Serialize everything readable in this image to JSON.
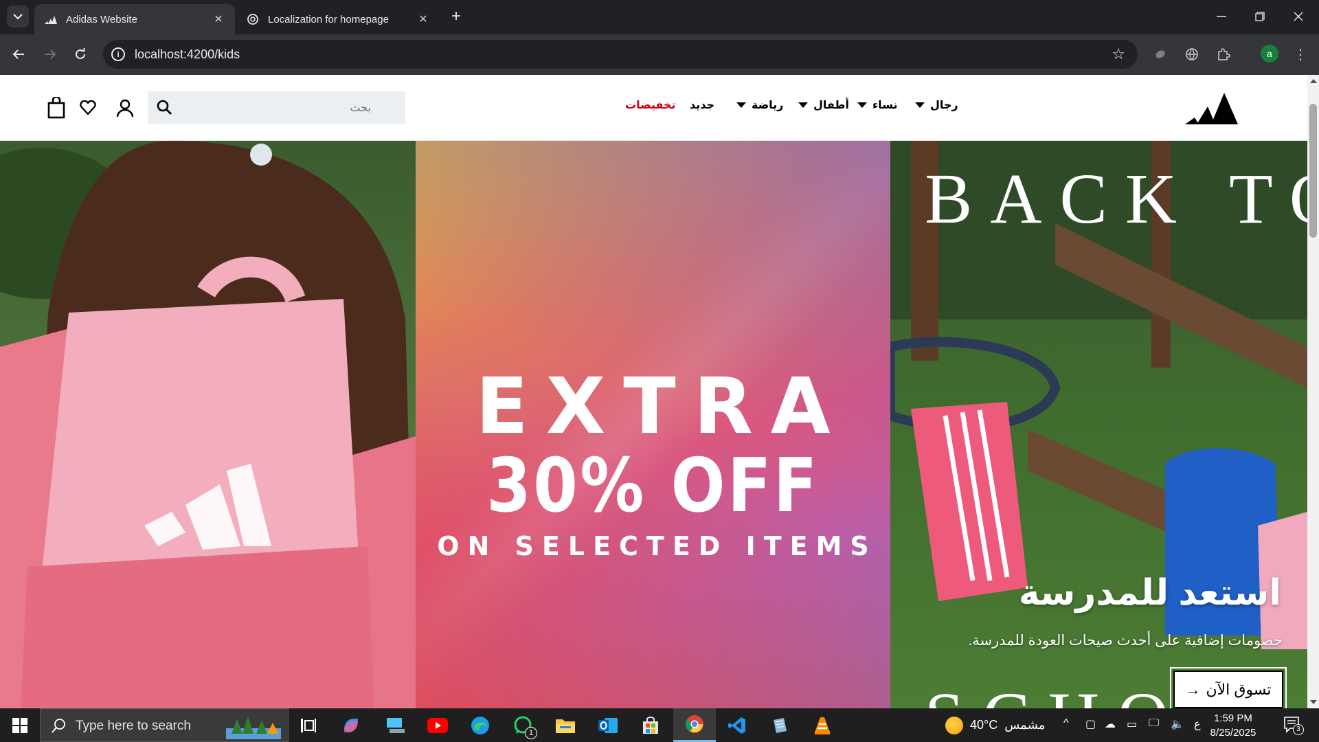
{
  "browser": {
    "tabs": [
      {
        "title": "Adidas Website",
        "active": true
      },
      {
        "title": "Localization for homepage",
        "active": false
      }
    ],
    "address": "localhost:4200/kids",
    "profile_initial": "a"
  },
  "site": {
    "search_placeholder": "بحث",
    "nav": [
      {
        "label": "رجال",
        "dropdown": true
      },
      {
        "label": "نساء",
        "dropdown": true
      },
      {
        "label": "أطفال",
        "dropdown": true
      },
      {
        "label": "رياضة",
        "dropdown": true
      },
      {
        "label": "جديد",
        "dropdown": false
      },
      {
        "label": "تخفيضات",
        "dropdown": false,
        "color": "#d0021b"
      }
    ]
  },
  "hero": {
    "promo": {
      "line1": "EXTRA",
      "line2": "30% OFF",
      "line3": "ON SELECTED ITEMS"
    },
    "back_to_school": {
      "title": "BACK TO",
      "bottom_word": "SCHOOL",
      "heading": "استعد للمدرسة",
      "subtext": "خصومات إضافية على أحدث صيحات العودة للمدرسة.",
      "cta": "تسوق الآن",
      "cta_arrow": "→"
    }
  },
  "taskbar": {
    "search_placeholder": "Type here to search",
    "whatsapp_badge": "1",
    "weather_temp": "40°C",
    "weather_desc": "مشمس",
    "ime": "ع",
    "time": "1:59 PM",
    "date": "8/25/2025",
    "notification_count": "3"
  }
}
